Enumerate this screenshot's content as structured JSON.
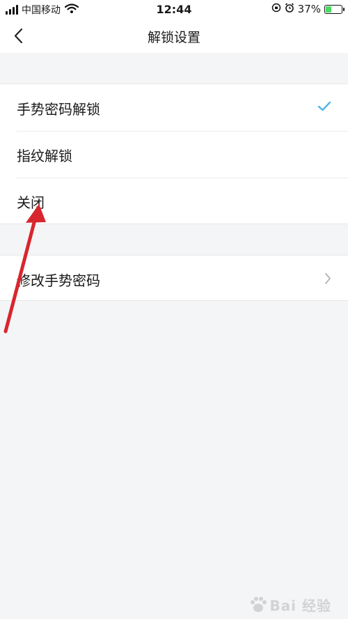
{
  "status_bar": {
    "carrier": "中国移动",
    "time": "12:44",
    "battery_percent": "37%",
    "battery_level": 0.37
  },
  "nav": {
    "title": "解锁设置",
    "back_icon": "chevron-left-icon"
  },
  "options": [
    {
      "label": "手势密码解锁",
      "selected": true
    },
    {
      "label": "指纹解锁",
      "selected": false
    },
    {
      "label": "关闭",
      "selected": false
    }
  ],
  "settings": {
    "change_password_label": "修改手势密码"
  },
  "colors": {
    "accent_check": "#4cb6e6",
    "annotation_arrow": "#d8262e",
    "background": "#f4f5f7"
  },
  "watermark": {
    "text": "Bai 经验"
  }
}
